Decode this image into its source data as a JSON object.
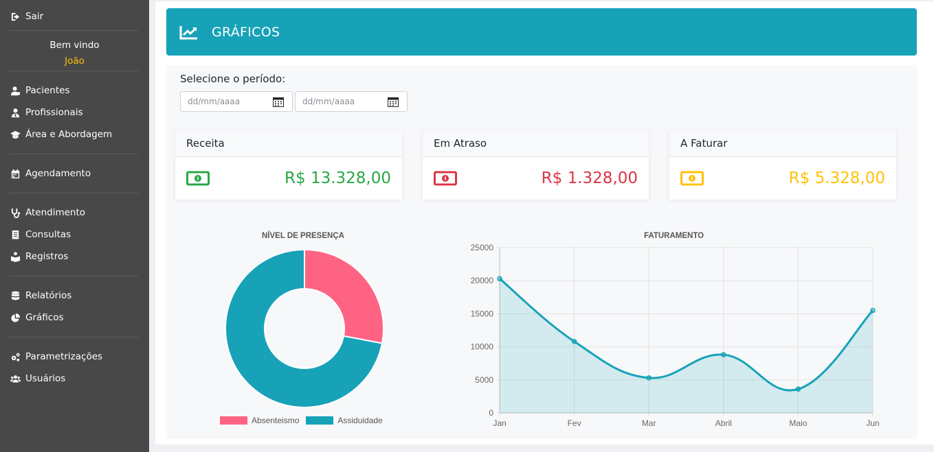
{
  "sidebar": {
    "logout": "Sair",
    "welcome": "Bem vindo",
    "user": "João",
    "groups": [
      [
        {
          "label": "Pacientes",
          "icon": "user-injured-icon"
        },
        {
          "label": "Profissionais",
          "icon": "user-doctor-icon"
        },
        {
          "label": "Área e Abordagem",
          "icon": "graduation-cap-icon"
        }
      ],
      [
        {
          "label": "Agendamento",
          "icon": "calendar-icon"
        }
      ],
      [
        {
          "label": "Atendimento",
          "icon": "stethoscope-icon"
        },
        {
          "label": "Consultas",
          "icon": "receipt-icon"
        },
        {
          "label": "Registros",
          "icon": "book-reader-icon"
        }
      ],
      [
        {
          "label": "Relatórios",
          "icon": "database-icon"
        },
        {
          "label": "Gráficos",
          "icon": "pie-chart-icon"
        }
      ],
      [
        {
          "label": "Parametrizações",
          "icon": "cogs-icon"
        },
        {
          "label": "Usuários",
          "icon": "users-icon"
        }
      ]
    ]
  },
  "header": {
    "title": "GRÁFICOS",
    "icon": "chart-line-icon"
  },
  "filters": {
    "label": "Selecione o período:",
    "start_placeholder": "dd/mm/aaaa",
    "end_placeholder": "dd/mm/aaaa"
  },
  "cards": [
    {
      "title": "Receita",
      "value": "R$ 13.328,00",
      "color": "#28a745"
    },
    {
      "title": "Em Atraso",
      "value": "R$ 1.328,00",
      "color": "#dc3545"
    },
    {
      "title": "A Faturar",
      "value": "R$ 5.328,00",
      "color": "#ffc107"
    }
  ],
  "colors": {
    "accent": "#17a2b8",
    "sidebar": "#484848",
    "pink": "#ff6384"
  },
  "chart_data": [
    {
      "type": "pie",
      "title": "NÍVEL DE PRESENÇA",
      "labels": [
        "Absenteismo",
        "Assiduidade"
      ],
      "values": [
        28,
        72
      ],
      "colors": [
        "#ff6384",
        "#17a2b8"
      ],
      "legend": "bottom"
    },
    {
      "type": "area",
      "title": "FATURAMENTO",
      "categories": [
        "Jan",
        "Fev",
        "Mar",
        "Abril",
        "Maio",
        "Jun"
      ],
      "series": [
        {
          "values": [
            20300,
            10800,
            5300,
            8800,
            3600,
            15500
          ]
        }
      ],
      "ylim": [
        0,
        25000
      ],
      "yticks": [
        0,
        5000,
        10000,
        15000,
        20000,
        25000
      ],
      "grid": true,
      "color": "#17a2b8"
    }
  ]
}
